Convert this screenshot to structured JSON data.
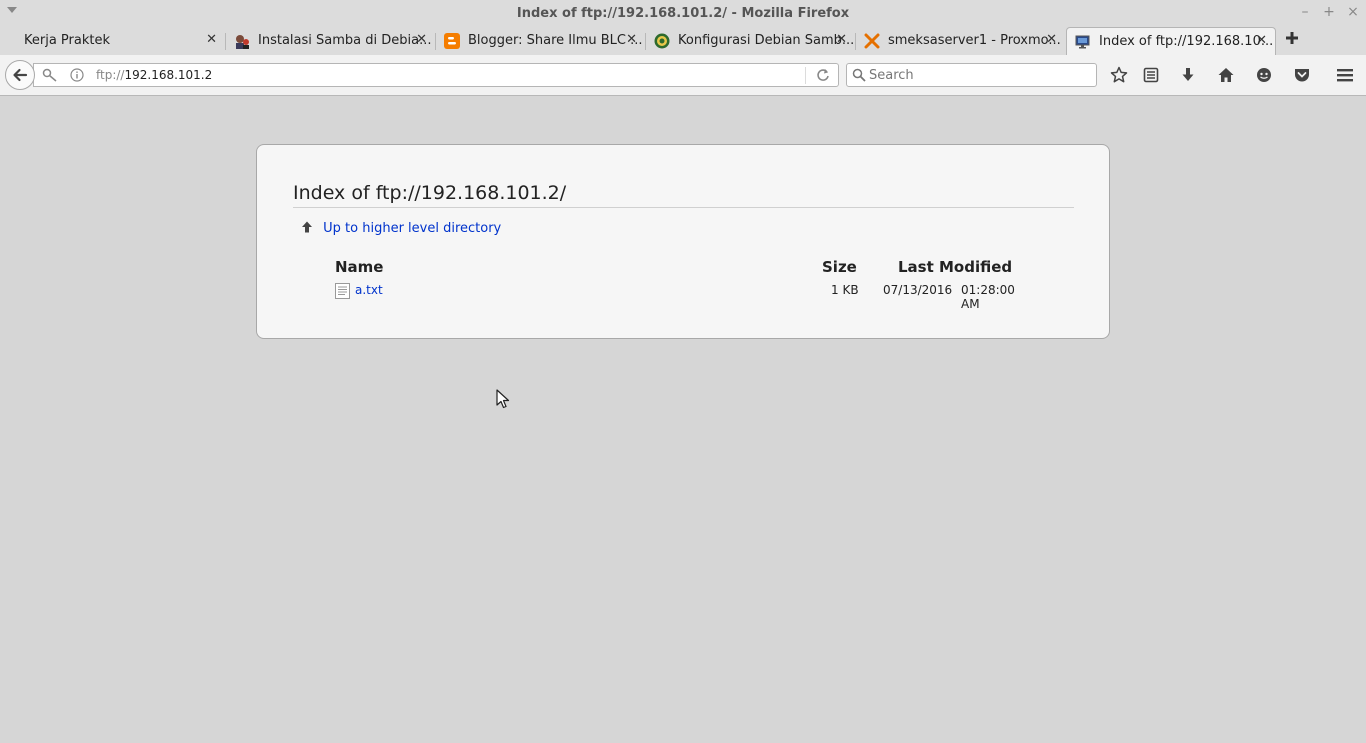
{
  "window": {
    "title": "Index of ftp://192.168.101.2/ - Mozilla Firefox",
    "minimize_label": "–",
    "maximize_label": "+",
    "close_label": "×"
  },
  "tabs": [
    {
      "label": "Kerja Praktek",
      "icon": "none",
      "close": "✕",
      "active": false
    },
    {
      "label": "Instalasi Samba di Debia...",
      "icon": "avatar-icon",
      "close": "✕",
      "active": false
    },
    {
      "label": "Blogger: Share Ilmu BLC ...",
      "icon": "blogger-icon",
      "close": "✕",
      "active": false
    },
    {
      "label": "Konfigurasi Debian Samb...",
      "icon": "school-logo-icon",
      "close": "✕",
      "active": false
    },
    {
      "label": "smeksaserver1 - Proxmo...",
      "icon": "proxmox-icon",
      "close": "✕",
      "active": false
    },
    {
      "label": "Index of ftp://192.168.10...",
      "icon": "monitor-icon",
      "close": "✕",
      "active": true
    }
  ],
  "newtab_label": "+",
  "navbar": {
    "url_scheme": "ftp://",
    "url_host": "192.168.101.2",
    "search_placeholder": "Search"
  },
  "listing": {
    "heading": "Index of ftp://192.168.101.2/",
    "up_link": "Up to higher level directory",
    "columns": {
      "name": "Name",
      "size": "Size",
      "modified": "Last Modified"
    },
    "files": [
      {
        "name": "a.txt",
        "size": "1 KB",
        "date": "07/13/2016",
        "time": "01:28:00 AM"
      }
    ]
  },
  "colors": {
    "link": "#0033cc",
    "page_background": "#d6d6d6",
    "panel_background": "#f6f6f6",
    "chrome_background": "#f2f2f2"
  }
}
